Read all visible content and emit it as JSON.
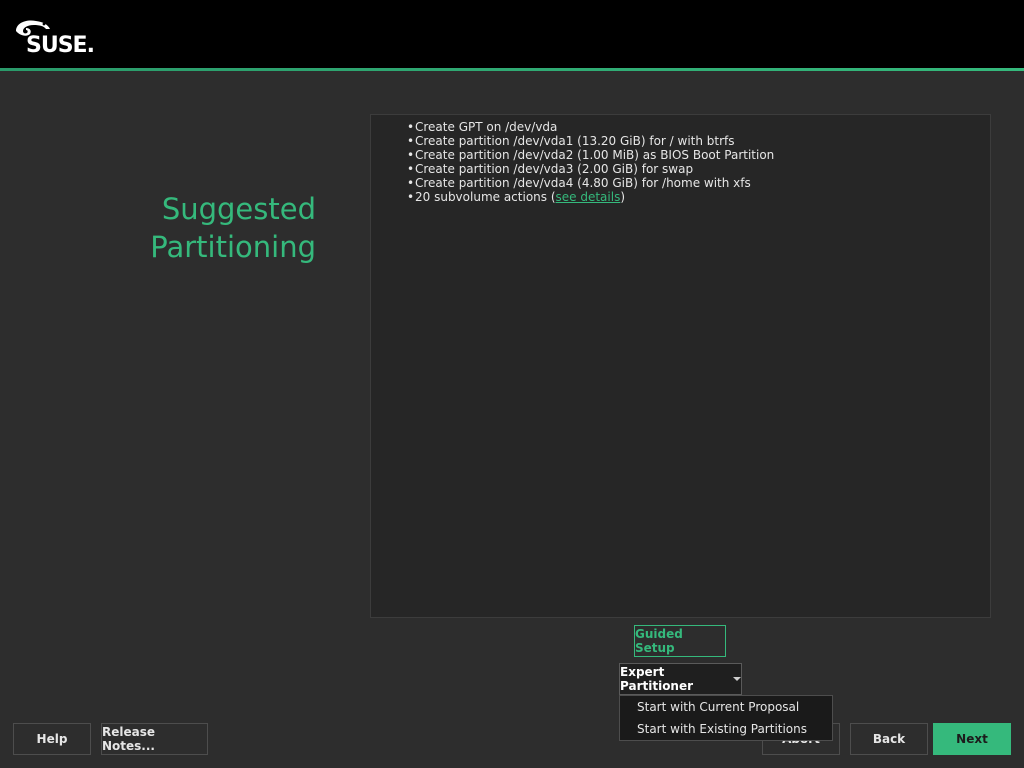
{
  "brand": {
    "logo_text": "SUSE."
  },
  "page": {
    "title_line1": "Suggested",
    "title_line2": "Partitioning"
  },
  "actions": [
    {
      "text": "Create GPT on /dev/vda"
    },
    {
      "text": "Create partition /dev/vda1 (13.20 GiB) for / with btrfs"
    },
    {
      "text": "Create partition /dev/vda2 (1.00 MiB) as BIOS Boot Partition"
    },
    {
      "text": "Create partition /dev/vda3 (2.00 GiB) for swap"
    },
    {
      "text": "Create partition /dev/vda4 (4.80 GiB) for /home with xfs"
    }
  ],
  "subvolume": {
    "prefix": "20 subvolume actions (",
    "link": "see details",
    "suffix": ")"
  },
  "buttons": {
    "guided_setup": "Guided Setup",
    "expert_partitioner": "Expert Partitioner",
    "help": "Help",
    "release_notes": "Release Notes...",
    "abort": "Abort",
    "back": "Back",
    "next": "Next"
  },
  "expert_menu": {
    "items": [
      {
        "label": "Start with Current Proposal"
      },
      {
        "label": "Start with Existing Partitions"
      }
    ]
  },
  "colors": {
    "accent": "#35b97c",
    "background": "#2d2d2d",
    "topbar": "#000000"
  }
}
